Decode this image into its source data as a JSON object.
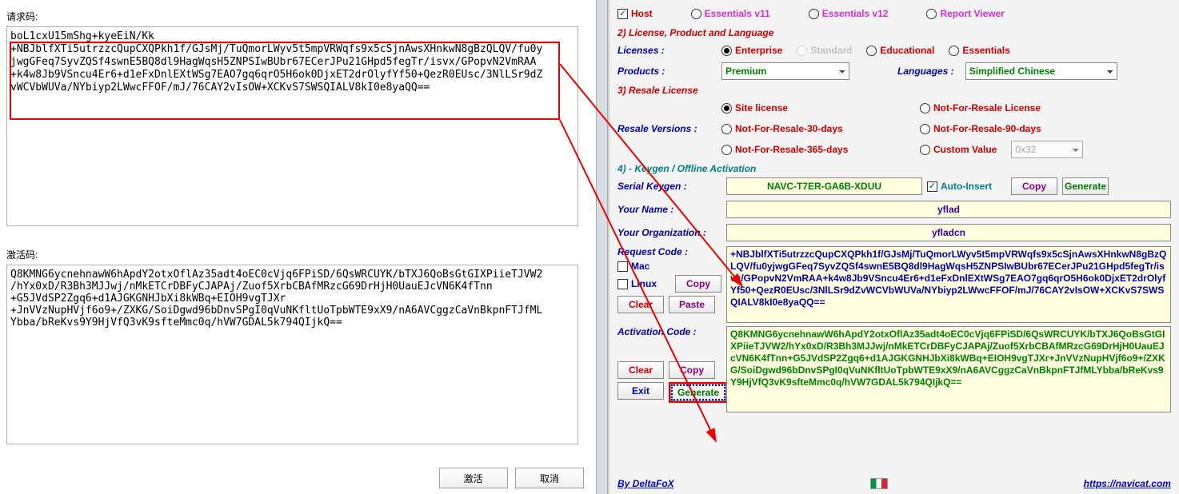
{
  "left": {
    "request_label": "请求码:",
    "request_code": "boL1cxU15mShg+kyeEiN/Kk\n+NBJblfXTi5utrzzcQupCXQPkh1f/GJsMj/TuQmorLWyv5t5mpVRWqfs9x5cSjnAwsXHnkwN8gBzQLQV/fu0y\njwgGFeq7SyvZQSf4swnE5BQ8dl9HagWqsH5ZNPSIwBUbr67ECerJPu21GHpd5fegTr/isvx/GPopvN2VmRAA\n+k4w8Jb9VSncu4Er6+d1eFxDnlEXtWSg7EAO7gq6qrO5H6ok0DjxET2drOlyfYf50+QezR0EUsc/3NlLSr9dZ\nvWCVbWUVa/NYbiyp2LWwcFFOF/mJ/76CAY2vIsOW+XCKvS7SWSQIALV8kI0e8yaQQ==",
    "activation_label": "激活码:",
    "activation_code": "Q8KMNG6ycnehnawW6hApdY2otxOflAz35adt4oEC0cVjq6FPiSD/6QsWRCUYK/bTXJ6QoBsGtGIXPiieTJVW2\n/hYx0xD/R3Bh3MJJwj/nMkETCrDBFyCJAPAj/Zuof5XrbCBAfMRzcG69DrHjH0UauEJcVN6K4fTnn\n+G5JVdSP2Zgq6+d1AJGKGNHJbXi8kWBq+EIOH9vgTJXr\n+JnVVzNupHVjf6o9+/ZXKG/SoiDgwd96bDnvSPgI0qVuNKfltUoTpbWTE9xX9/nA6AVCggzCaVnBkpnFTJfML\nYbba/bReKvs9Y9HjVfQ3vK9sfteMmc0q/hVW7GDAL5k794QIjkQ==",
    "btn_activate": "激活",
    "btn_cancel": "取消"
  },
  "right": {
    "top_host": "Host",
    "top_ev11": "Essentials v11",
    "top_ev12": "Essentials v12",
    "top_rv": "Report Viewer",
    "s2": "2) License, Product and Language",
    "licenses_label": "Licenses :",
    "lic_ent": "Enterprise",
    "lic_std": "Standard",
    "lic_edu": "Educational",
    "lic_ess": "Essentials",
    "products_label": "Products :",
    "product_sel": "Premium",
    "lang_label": "Languages :",
    "lang_sel": "Simplified Chinese",
    "s3": "3) Resale License",
    "resale_label": "Resale Versions :",
    "r_site": "Site license",
    "r_nfr": "Not-For-Resale License",
    "r_30": "Not-For-Resale-30-days",
    "r_90": "Not-For-Resale-90-days",
    "r_365": "Not-For-Resale-365-days",
    "r_custom": "Custom Value",
    "r_custom_val": "0x32",
    "s4": "4) - Keygen / Offline Activation",
    "serial_label": "Serial Keygen :",
    "serial": "NAVC-T7ER-GA6B-XDUU",
    "auto_insert": "Auto-Insert",
    "copy": "Copy",
    "generate": "Generate",
    "name_label": "Your Name :",
    "name": "yflad",
    "org_label": "Your Organization :",
    "org": "yfladcn",
    "req_label": "Request Code :",
    "mac": "Mac",
    "linux": "Linux",
    "clear": "Clear",
    "paste": "Paste",
    "req_code": "+NBJblfXTi5utrzzcQupCXQPkh1f/GJsMj/TuQmorLWyv5t5mpVRWqfs9x5cSjnAwsXHnkwN8gBzQLQV/fu0yjwgGFeq7SyvZQSf4swnE5BQ8dl9HagWqsH5ZNPSIwBUbr67ECerJPu21GHpd5fegTr/isvx/GPopvN2VmRAA+k4w8Jb9VSncu4Er6+d1eFxDnlEXtWSg7EAO7gq6qrO5H6ok0DjxET2drOlyfYf50+QezR0EUsc/3NlLSr9dZvWCVbWUVa/NYbiyp2LWwcFFOF/mJ/76CAY2vIsOW+XCKvS7SWSQIALV8kI0e8yaQQ==",
    "act_label": "Activation Code :",
    "act_code": "Q8KMNG6ycnehnawW6hApdY2otxOflAz35adt4oEC0cVjq6FPiSD/6QsWRCUYK/bTXJ6QoBsGtGIXPiieTJVW2/hYx0xD/R3Bh3MJJwj/nMkETCrDBFyCJAPAj/Zuof5XrbCBAfMRzcG69DrHjH0UauEJcVN6K4fTnn+G5JVdSP2Zgq6+d1AJGKGNHJbXi8kWBq+EIOH9vgTJXr+JnVVzNupHVjf6o9+/ZXKG/SoiDgwd96bDnvSPgI0qVuNKfltUoTpbWTE9xX9/nA6AVCggzCaVnBkpnFTJfMLYbba/bReKvs9Y9HjVfQ3vK9sfteMmc0q/hVW7GDAL5k794QIjkQ==",
    "exit": "Exit",
    "by": "By DeltaFoX",
    "url": "https://navicat.com"
  }
}
